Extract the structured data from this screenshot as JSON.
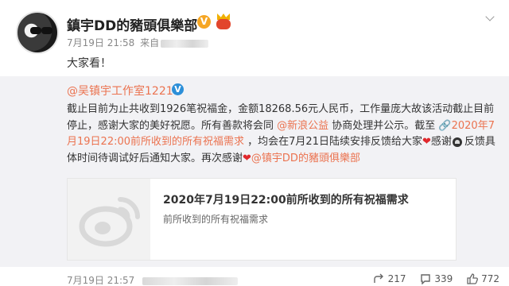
{
  "post": {
    "username": "鎮宇DD的豬頭俱樂部",
    "v_badge": "V",
    "time": "7月19日 21:58",
    "source_prefix": "来自",
    "text": "大家看！"
  },
  "repost": {
    "author": "@吴镇宇工作室1221",
    "v_badge": "V",
    "text_1": "截止目前为止共收到1926笔祝福金，金额18268.56元人民币，工作量庞大故该活动截止目前停止，感谢大家的美好祝愿。所有善款将会同 ",
    "mention_1": "@新浪公益",
    "text_2": " 协商处理并公示。截至 ",
    "link_text": "🔗2020年7月19日22:00前所收到的所有祝福需求",
    "text_3": " ，均会在7月21日陆续安排反馈给大家",
    "text_4": "感谢",
    "text_5": "反馈具体时间待调试好后通知大家。再次感谢",
    "mention_2": "@镇宇DD的豬頭俱樂部",
    "heart": "❤",
    "card": {
      "title": "2020年7月19日22:00前所收到的所有祝福需求",
      "subtitle": "前所收到的所有祝福需求"
    },
    "time": "7月19日 21:57",
    "share_count": "217",
    "comment_count": "339",
    "like_count": "772"
  },
  "colors": {
    "accent": "#eb7350",
    "heart": "#e0282c",
    "repost_bg": "#f2f2f5"
  },
  "icons": [
    "chevron-down-icon",
    "share-icon",
    "comment-icon",
    "like-icon",
    "weibo-logo-icon"
  ]
}
